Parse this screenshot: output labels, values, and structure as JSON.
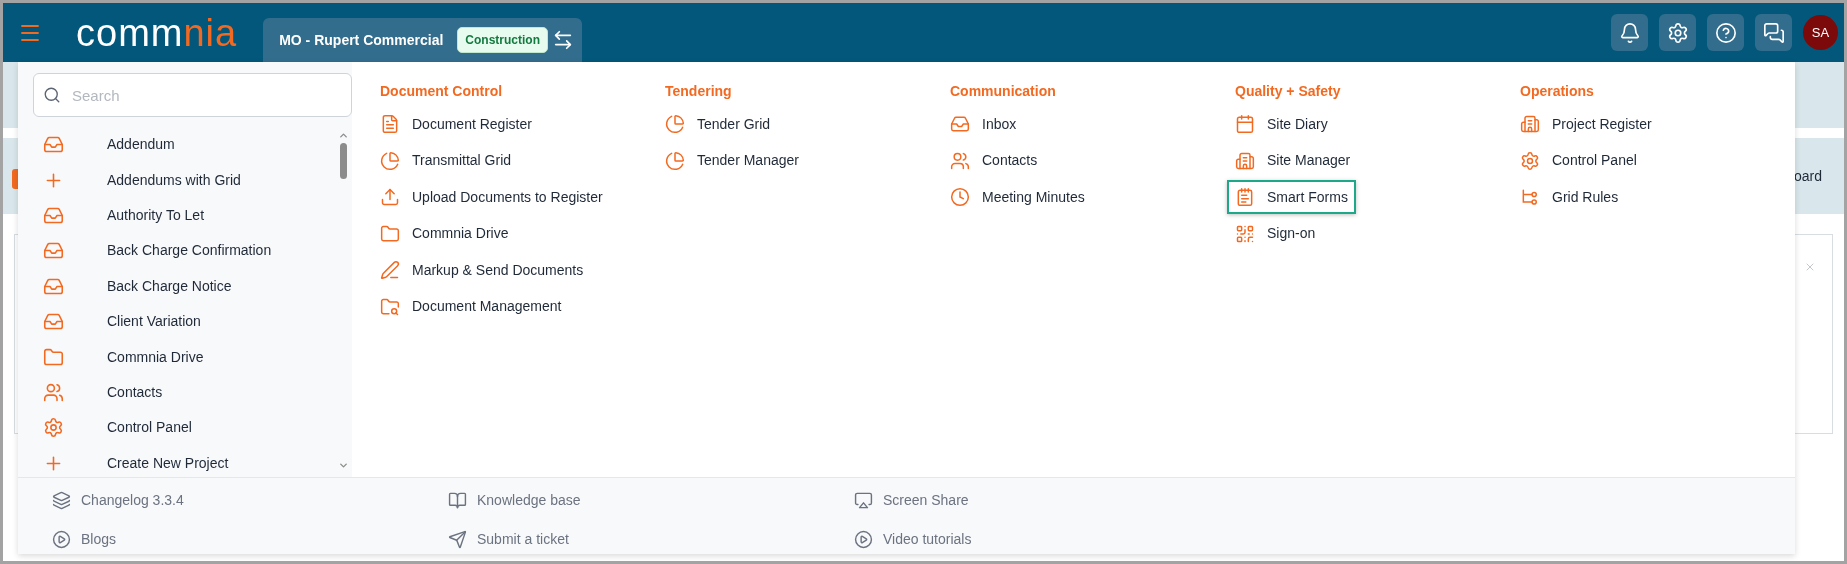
{
  "header": {
    "logo": {
      "primary": "comm",
      "accent": "nia"
    },
    "project": {
      "name": "MO - Rupert Commercial",
      "badge": "Construction"
    },
    "avatar": "SA"
  },
  "background": {
    "band_text": "oard"
  },
  "menu": {
    "search": {
      "placeholder": "Search"
    },
    "list": [
      {
        "label": "Addendum",
        "kind": "inbox"
      },
      {
        "label": "Addendums with Grid",
        "kind": "plus"
      },
      {
        "label": "Authority To Let",
        "kind": "inbox"
      },
      {
        "label": "Back Charge Confirmation",
        "kind": "inbox"
      },
      {
        "label": "Back Charge Notice",
        "kind": "inbox"
      },
      {
        "label": "Client Variation",
        "kind": "inbox"
      },
      {
        "label": "Commnia Drive",
        "kind": "folder"
      },
      {
        "label": "Contacts",
        "kind": "users"
      },
      {
        "label": "Control Panel",
        "kind": "gear"
      },
      {
        "label": "Create New Project",
        "kind": "plus"
      }
    ],
    "sections": [
      {
        "title": "Document Control",
        "items": [
          {
            "label": "Document Register",
            "kind": "document",
            "highlighted": false
          },
          {
            "label": "Transmittal Grid",
            "kind": "pie",
            "highlighted": false
          },
          {
            "label": "Upload Documents to Register",
            "kind": "upload",
            "highlighted": false
          },
          {
            "label": "Commnia Drive",
            "kind": "folder",
            "highlighted": false
          },
          {
            "label": "Markup & Send Documents",
            "kind": "pen",
            "highlighted": false
          },
          {
            "label": "Document Management",
            "kind": "search",
            "highlighted": false
          }
        ]
      },
      {
        "title": "Tendering",
        "items": [
          {
            "label": "Tender Grid",
            "kind": "pie",
            "highlighted": false
          },
          {
            "label": "Tender Manager",
            "kind": "pie",
            "highlighted": false
          }
        ]
      },
      {
        "title": "Communication",
        "items": [
          {
            "label": "Inbox",
            "kind": "inbox",
            "highlighted": false
          },
          {
            "label": "Contacts",
            "kind": "users",
            "highlighted": false
          },
          {
            "label": "Meeting Minutes",
            "kind": "clock",
            "highlighted": false
          }
        ]
      },
      {
        "title": "Quality + Safety",
        "items": [
          {
            "label": "Site Diary",
            "kind": "calendar",
            "highlighted": false
          },
          {
            "label": "Site Manager",
            "kind": "building",
            "highlighted": false
          },
          {
            "label": "Smart Forms",
            "kind": "form",
            "highlighted": true
          },
          {
            "label": "Sign-on",
            "kind": "qr",
            "highlighted": false
          }
        ]
      },
      {
        "title": "Operations",
        "items": [
          {
            "label": "Project Register",
            "kind": "building",
            "highlighted": false
          },
          {
            "label": "Control Panel",
            "kind": "gear",
            "highlighted": false
          },
          {
            "label": "Grid Rules",
            "kind": "branch",
            "highlighted": false
          }
        ]
      }
    ],
    "footer": [
      [
        {
          "label": "Changelog 3.3.4",
          "kind": "layers"
        },
        {
          "label": "Blogs",
          "kind": "play"
        }
      ],
      [
        {
          "label": "Knowledge base",
          "kind": "book"
        },
        {
          "label": "Submit a ticket",
          "kind": "send"
        }
      ],
      [
        {
          "label": "Screen Share",
          "kind": "screen"
        },
        {
          "label": "Video tutorials",
          "kind": "play"
        }
      ]
    ]
  }
}
